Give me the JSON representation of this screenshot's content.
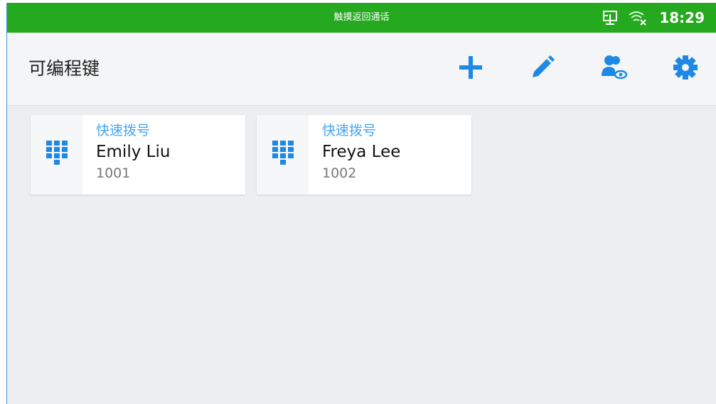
{
  "status_bar": {
    "center_text": "触摸返回通话",
    "time": "18:29",
    "background": "#25a91f",
    "icons": [
      "network-icon",
      "wifi-off-icon"
    ]
  },
  "app_bar": {
    "title": "可编程键",
    "actions": [
      "plus-icon",
      "pencil-icon",
      "contacts-eye-icon",
      "gear-icon"
    ],
    "accent": "#1e88e5"
  },
  "cards": [
    {
      "type": "快速拨号",
      "name": "Emily Liu",
      "number": "1001",
      "icon": "dialpad-icon"
    },
    {
      "type": "快速拨号",
      "name": "Freya Lee",
      "number": "1002",
      "icon": "dialpad-icon"
    }
  ]
}
